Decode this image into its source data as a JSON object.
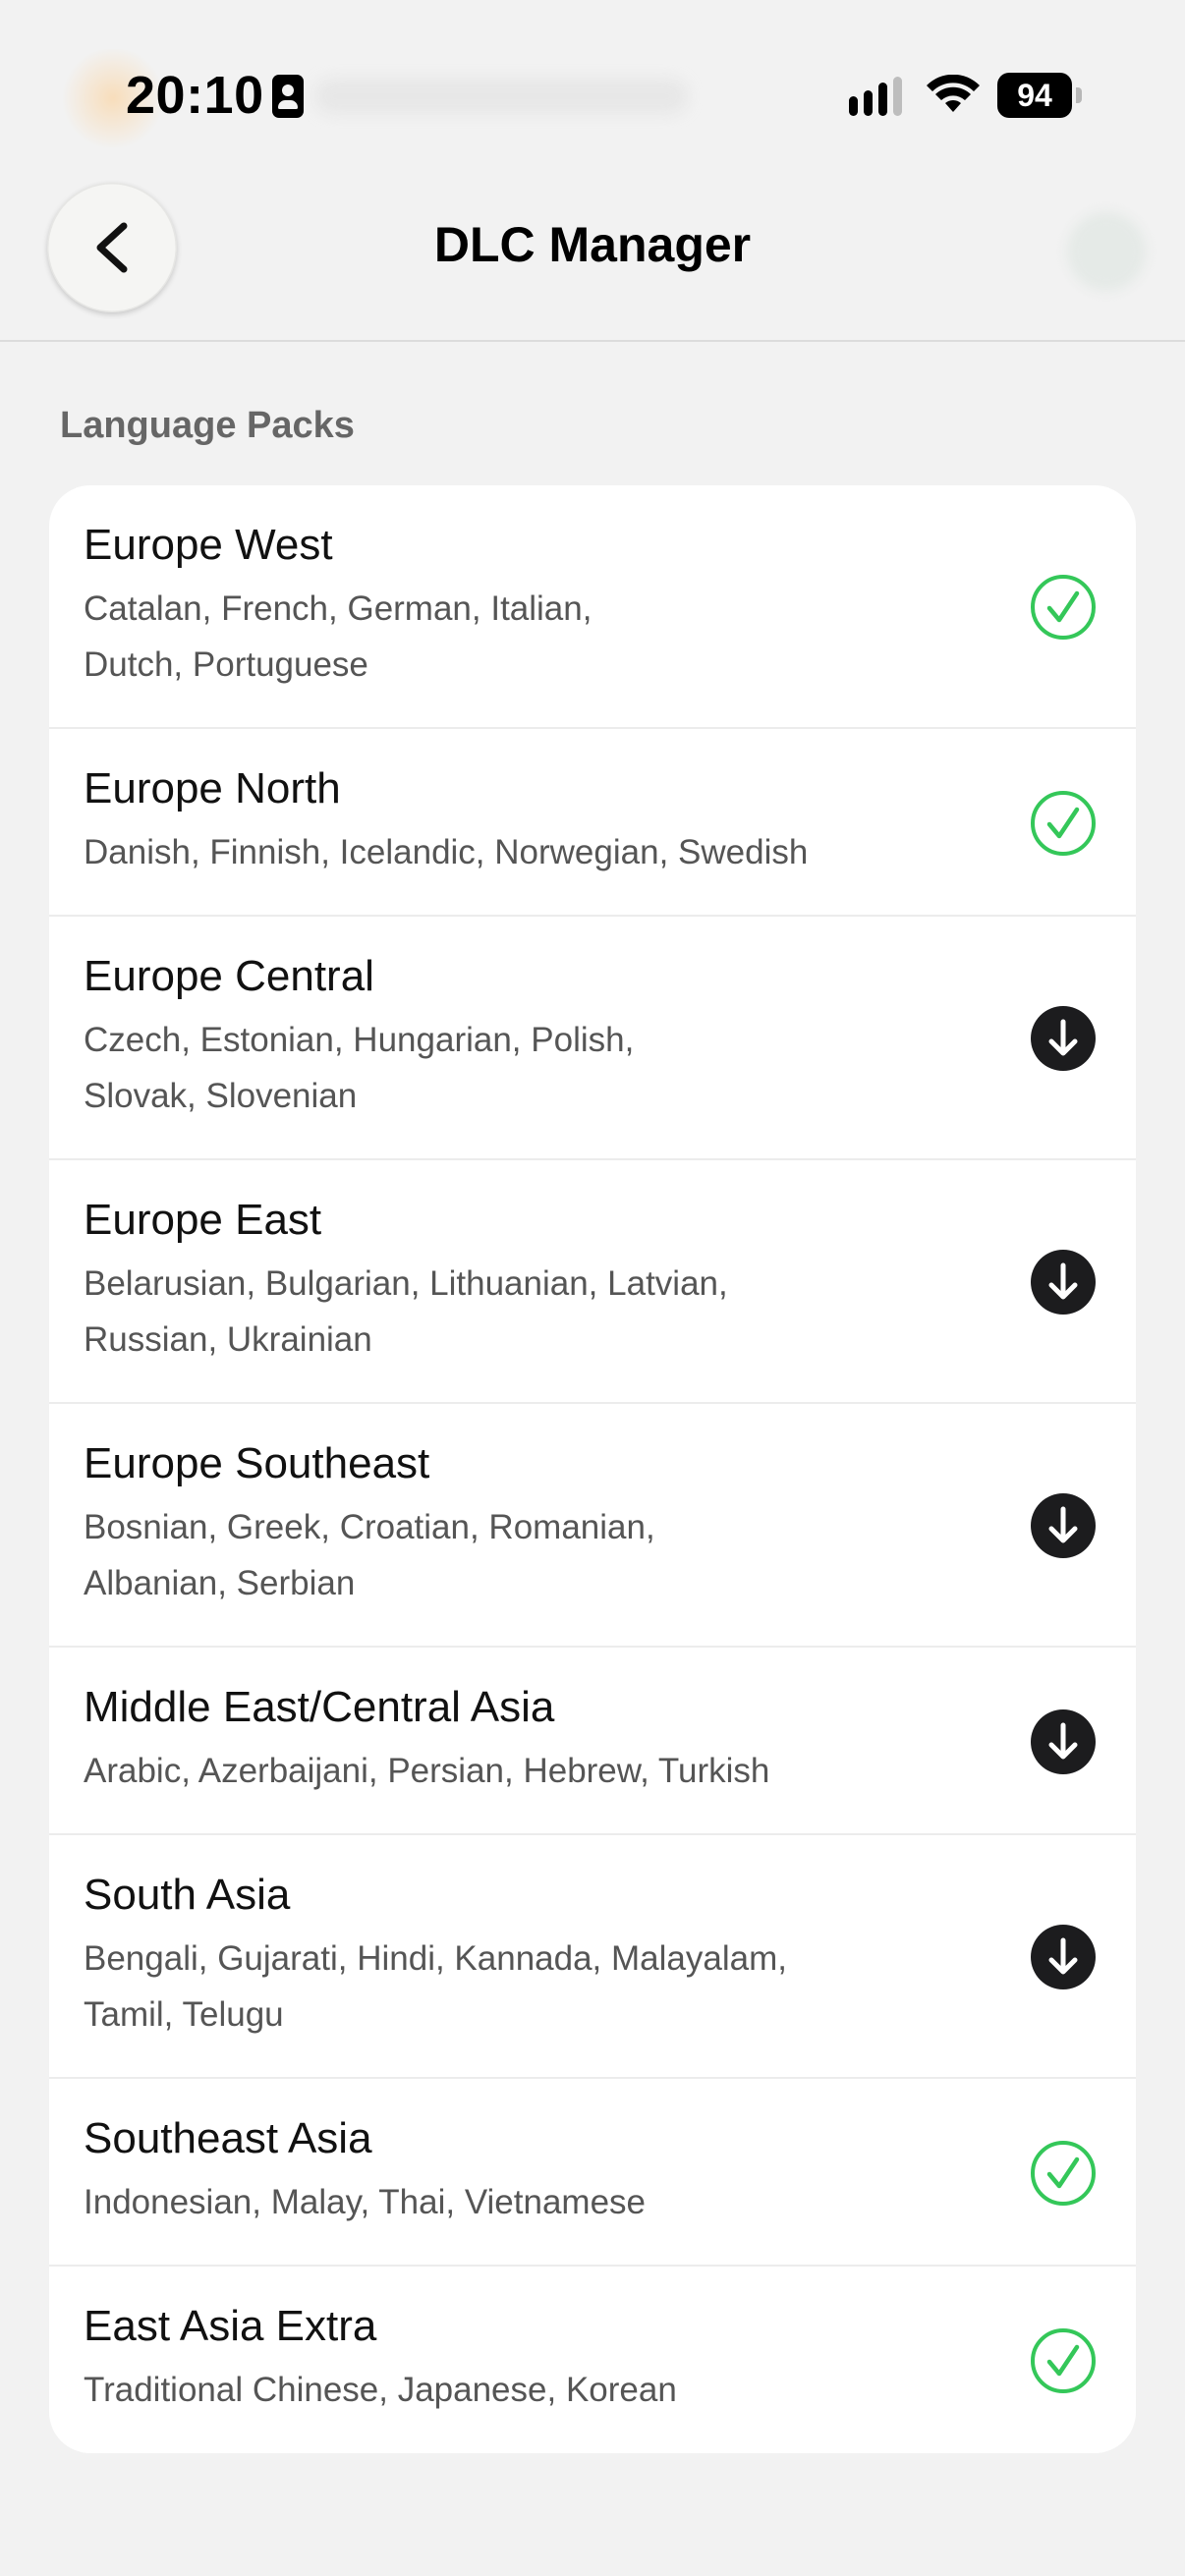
{
  "status_bar": {
    "time": "20:10",
    "battery": "94",
    "icons": [
      "id-card-icon",
      "cellular-signal-icon",
      "wifi-icon",
      "battery-icon"
    ]
  },
  "nav": {
    "title": "DLC Manager",
    "back_icon": "chevron-left-icon"
  },
  "section": {
    "header": "Language Packs"
  },
  "colors": {
    "installed": "#34c759",
    "download": "#1c1c1e"
  },
  "packs": [
    {
      "name": "Europe West",
      "line1": "Catalan, French, German, Italian,",
      "line2": "Dutch, Portuguese",
      "status": "installed"
    },
    {
      "name": "Europe North",
      "line1": "Danish, Finnish, Icelandic, Norwegian, Swedish",
      "line2": "",
      "status": "installed"
    },
    {
      "name": "Europe Central",
      "line1": "Czech, Estonian, Hungarian, Polish,",
      "line2": "Slovak, Slovenian",
      "status": "download"
    },
    {
      "name": "Europe East",
      "line1": "Belarusian, Bulgarian, Lithuanian, Latvian,",
      "line2": "Russian, Ukrainian",
      "status": "download"
    },
    {
      "name": "Europe Southeast",
      "line1": "Bosnian, Greek, Croatian, Romanian,",
      "line2": "Albanian, Serbian",
      "status": "download"
    },
    {
      "name": "Middle East/Central Asia",
      "line1": "Arabic, Azerbaijani, Persian, Hebrew, Turkish",
      "line2": "",
      "status": "download"
    },
    {
      "name": "South Asia",
      "line1": "Bengali, Gujarati, Hindi, Kannada, Malayalam,",
      "line2": "Tamil, Telugu",
      "status": "download"
    },
    {
      "name": "Southeast Asia",
      "line1": "Indonesian, Malay, Thai, Vietnamese",
      "line2": "",
      "status": "installed"
    },
    {
      "name": "East Asia Extra",
      "line1": "Traditional Chinese, Japanese, Korean",
      "line2": "",
      "status": "installed"
    }
  ]
}
